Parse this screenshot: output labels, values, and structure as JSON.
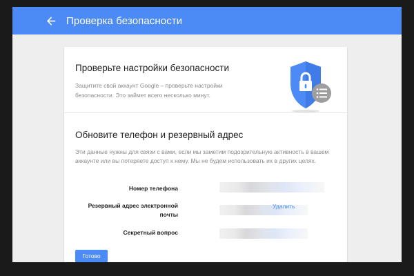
{
  "header": {
    "title": "Проверка безопасности",
    "back_icon": "arrow-left-icon",
    "color": "#4c8bf5"
  },
  "intro": {
    "title": "Проверьте настройки безопасности",
    "description": "Защитите свой аккаунт Google – проверьте настройки безопасности. Это займет всего несколько минут.",
    "illustration_icon": "shield-lock-icon"
  },
  "contact": {
    "title": "Обновите телефон и резервный адрес",
    "description": "Эти данные нужны для связи с вами, если мы заметим подозрительную активность в вашем аккаунте или вы потеряете доступ к нему. Мы не будем использовать их в других целях.",
    "rows": [
      {
        "label": "Номер телефона",
        "value": ""
      },
      {
        "label": "Резервный адрес электронной почты",
        "value": "",
        "action": "Удалить"
      },
      {
        "label": "Секретный вопрос",
        "value": ""
      }
    ]
  },
  "actions": {
    "done_label": "Готово"
  }
}
